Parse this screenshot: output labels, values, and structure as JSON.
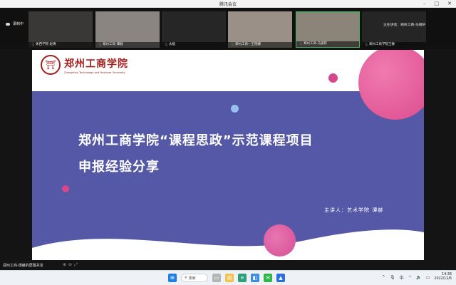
{
  "window": {
    "title": "腾讯会议"
  },
  "recording": {
    "label": "录制中"
  },
  "participants": [
    {
      "name": "休西学院-赵倩"
    },
    {
      "name": "郑州工商-谭赫"
    },
    {
      "name": "太极"
    },
    {
      "name": "郑州工商—王晓娜"
    },
    {
      "name": "郑州工商-马丽轩"
    },
    {
      "name": "郑州工商学院王静"
    }
  ],
  "speaking": {
    "label": "正在讲话：郑州工商-马丽轩"
  },
  "slide": {
    "logo_cn": "郑州工商学院",
    "logo_en": "Zhengzhou Technology and Business University",
    "title_line1": "郑州工商学院“课程思政”示范课程项目",
    "title_line2": "申报经验分享",
    "presenter": "主讲人：艺术学院  谭赫"
  },
  "share": {
    "label": "郑州工商-谭赫的屏幕共享"
  },
  "taskbar": {
    "search_label": "搜索",
    "time": "14:36",
    "date": "2022/12/6",
    "ime": "中"
  },
  "icons": [
    "record-icon",
    "mic-icon",
    "windows-start-icon",
    "search-icon",
    "file-explorer-icon",
    "edge-browser-icon",
    "wechat-icon",
    "meeting-app-icon",
    "wifi-icon",
    "volume-icon",
    "battery-icon"
  ]
}
